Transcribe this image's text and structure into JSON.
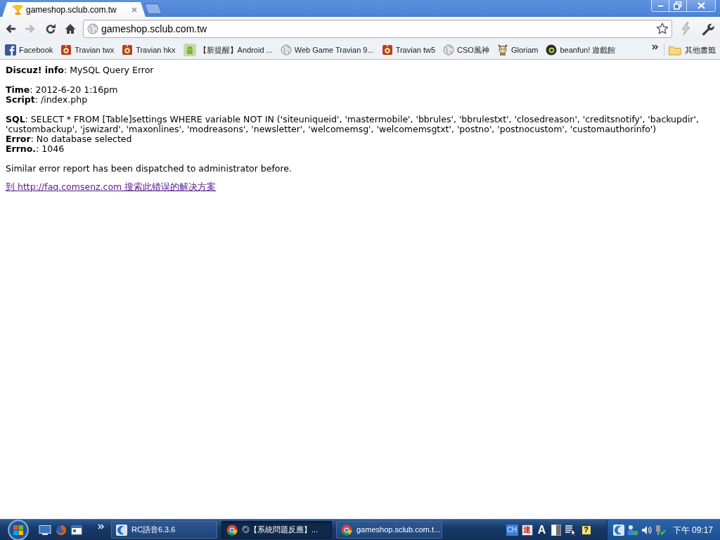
{
  "tabs": [
    {
      "title": "gameshop.sclub.com.tw",
      "selected": true
    }
  ],
  "toolbar": {
    "address": "gameshop.sclub.com.tw"
  },
  "bookmarks": [
    {
      "label": "Facebook",
      "kind": "facebook"
    },
    {
      "label": "Travian twx",
      "kind": "shield"
    },
    {
      "label": "Travian hkx",
      "kind": "shield"
    },
    {
      "label": "【新提醒】Android ...",
      "kind": "android"
    },
    {
      "label": "Web Game Travian 9...",
      "kind": "globe"
    },
    {
      "label": "Travian tw5",
      "kind": "shield"
    },
    {
      "label": "CSO風神",
      "kind": "globe"
    },
    {
      "label": "Gloriam",
      "kind": "mascot"
    },
    {
      "label": "beanfun! 遊戲館",
      "kind": "coin"
    }
  ],
  "other_bookmarks": {
    "label": "其他書籤"
  },
  "error_report": {
    "sections": [
      [
        {
          "label": "Discuz! info",
          "text": ": MySQL Query Error"
        }
      ],
      [
        {
          "label": "Time",
          "text": ": 2012-6-20 1:16pm"
        },
        {
          "label": "Script",
          "text": ": /index.php"
        }
      ],
      [
        {
          "label": "SQL",
          "text": ": SELECT * FROM [Table]settings WHERE variable NOT IN ('siteuniqueid', 'mastermobile', 'bbrules', 'bbrulestxt', 'closedreason', 'creditsnotify', 'backupdir', 'custombackup', 'jswizard', 'maxonlines', 'modreasons', 'newsletter', 'welcomemsg', 'welcomemsgtxt', 'postno', 'postnocustom', 'customauthorinfo')"
        },
        {
          "label": "Error",
          "text": ": No database selected"
        },
        {
          "label": "Errno.",
          "text": ": 1046"
        }
      ]
    ],
    "notice": "Similar error report has been dispatched to administrator before.",
    "help_link": "到 http://faq.comsenz.com 搜索此错误的解决方案"
  },
  "taskbar": {
    "tasks": [
      {
        "label": "RC語音6.3.6",
        "kind": "rc",
        "selected": false
      },
      {
        "label": "◎【系統問題反應】...",
        "kind": "chrome",
        "selected": true
      },
      {
        "label": "gameshop.sclub.com.t...",
        "kind": "chrome",
        "selected": false
      }
    ],
    "language": "CH",
    "ime_items": [
      {
        "kind": "glyph",
        "text": "速"
      },
      {
        "kind": "letter",
        "text": "A"
      },
      {
        "kind": "half"
      },
      {
        "kind": "pointer"
      },
      {
        "kind": "help",
        "text": "?"
      }
    ],
    "clock": "下午 09:17"
  }
}
